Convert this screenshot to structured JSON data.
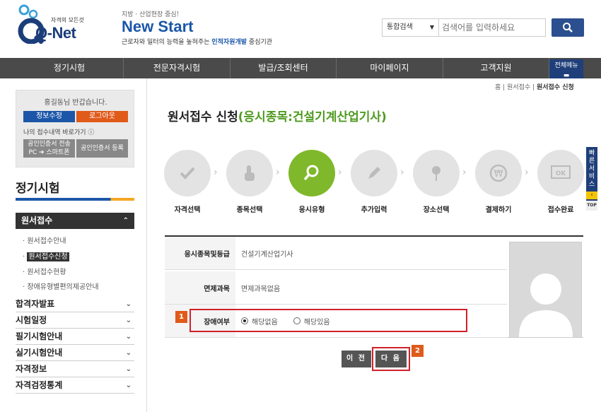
{
  "header": {
    "logo_tagline": "자격의 모든것",
    "logo_brand": "Q-Net",
    "promo_sub": "지방 · 산업현장 중심!",
    "promo_title": "New Start",
    "promo_desc_1": "근로자와 일터의 능력을 높혀주는 ",
    "promo_desc_highlight": "인적자원개발",
    "promo_desc_2": " 중심기관",
    "search_scope": "통합검색",
    "search_placeholder": "검색어를 입력하세요",
    "search_button_icon": "search-icon"
  },
  "nav": {
    "items": [
      "정기시험",
      "전문자격시험",
      "발급/조회센터",
      "마이페이지",
      "고객지원"
    ],
    "all_menu": "전체메뉴"
  },
  "sidebar": {
    "greeting": "홍길동님 반갑습니다.",
    "info_edit": "정보수정",
    "logout": "로그아웃",
    "shortcut": "나의 접수내역 바로가기",
    "cert_transfer_1": "공인인증서 전송",
    "cert_transfer_2": "PC ➔ 스마트폰",
    "cert_register": "공인인증서 등록",
    "section_title": "정기시험",
    "active_menu": "원서접수",
    "sub_items": [
      "원서접수안내",
      "원서접수신청",
      "원서접수현황",
      "장애유형별편의제공안내"
    ],
    "categories": [
      "합격자발표",
      "시험일정",
      "필기시험안내",
      "실기시험안내",
      "자격정보",
      "자격검정통계"
    ]
  },
  "breadcrumb": {
    "home": "홈",
    "level1": "원서접수",
    "current": "원서접수 신청"
  },
  "page": {
    "title_main": "원서접수 신청",
    "title_sub": "(응시종목:건설기계산업기사)"
  },
  "steps": [
    "자격선택",
    "종목선택",
    "응시유형",
    "추가입력",
    "장소선택",
    "결제하기",
    "접수완료"
  ],
  "form": {
    "row1_label": "응시종목및등급",
    "row1_value": "건설기계산업기사",
    "row2_label": "면제과목",
    "row2_value": "면제과목없음",
    "row3_label": "장애여부",
    "option_no": "해당없음",
    "option_yes": "해당있음"
  },
  "buttons": {
    "prev": "이 전",
    "next": "다 음"
  },
  "badges": {
    "b1": "1",
    "b2": "2"
  },
  "quick": {
    "label": "빠른서비스",
    "top": "TOP"
  }
}
